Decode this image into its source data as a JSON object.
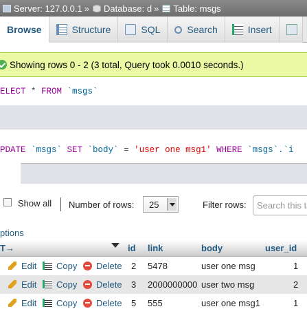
{
  "breadcrumb": {
    "server": "Server: 127.0.0.1",
    "database": "Database: d",
    "table": "Table: msgs",
    "separator": "»"
  },
  "tabs": [
    {
      "label": "Browse",
      "icon": "browse-icon",
      "active": true
    },
    {
      "label": "Structure",
      "icon": "structure-icon"
    },
    {
      "label": "SQL",
      "icon": "sql-icon"
    },
    {
      "label": "Search",
      "icon": "search-icon"
    },
    {
      "label": "Insert",
      "icon": "insert-icon"
    }
  ],
  "message": "Showing rows 0 - 2 (3 total, Query took 0.0010 seconds.)",
  "query1": {
    "kw1": "ELECT",
    "star": " * ",
    "kw2": "FROM",
    "table": " `msgs`"
  },
  "query2": {
    "kw1": "PDATE",
    "table": " `msgs` ",
    "kw2": "SET",
    "col": " `body` ",
    "eq": "= ",
    "value": "'user one msg1'",
    "kw3": " WHERE",
    "rest": " `msgs`.`i"
  },
  "nav": {
    "show_all": "Show all",
    "rows_label": "Number of rows:",
    "rows_value": "25",
    "filter_label": "Filter rows:",
    "filter_placeholder": "Search this table"
  },
  "options_link": "ptions",
  "table": {
    "toggle": "T→",
    "headers": [
      "id",
      "link",
      "body",
      "user_id"
    ],
    "actions": {
      "edit": "Edit",
      "copy": "Copy",
      "delete": "Delete"
    },
    "rows": [
      {
        "id": "2",
        "link": "5478",
        "body": "user one msg",
        "user_id": "1"
      },
      {
        "id": "3",
        "link": "2000000000",
        "body": "user two msg",
        "user_id": "2"
      },
      {
        "id": "5",
        "link": "555",
        "body": "user one msg1",
        "user_id": "1"
      }
    ]
  },
  "colors": {
    "banner": "#ebf8a4",
    "link": "#235a81",
    "keyword": "#990099",
    "string": "#dd0000"
  }
}
